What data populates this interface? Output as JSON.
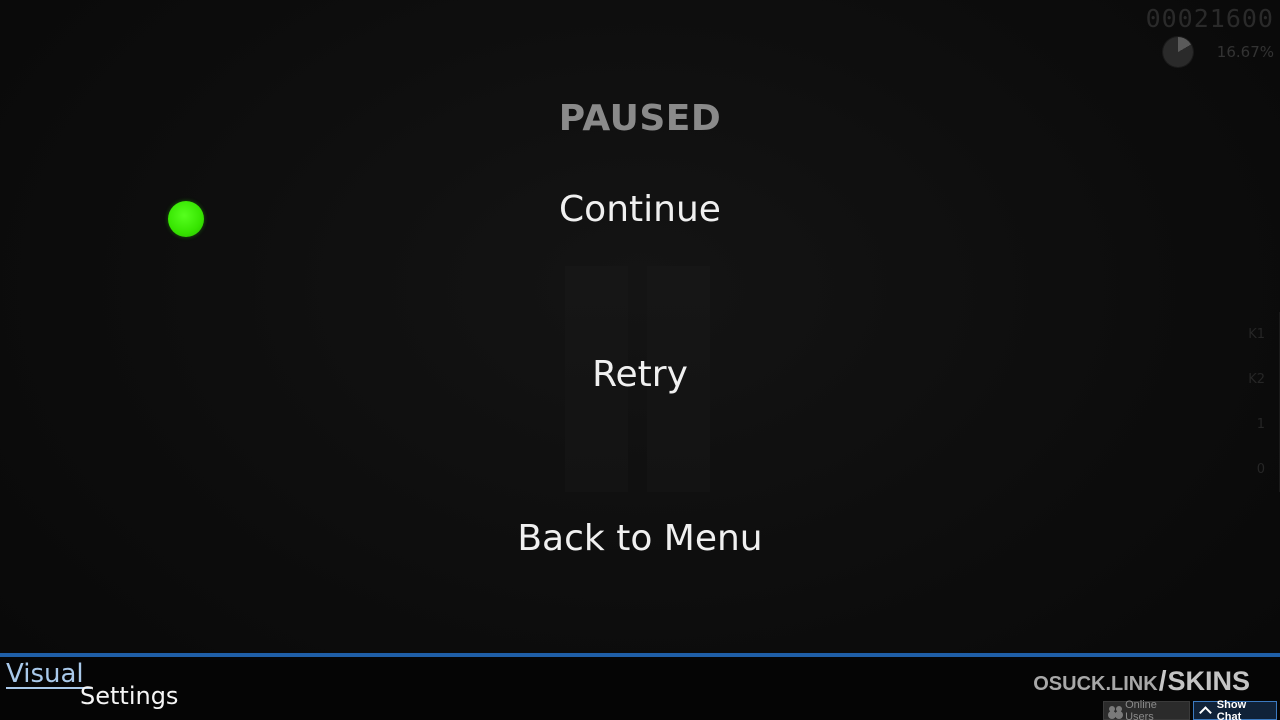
{
  "hud": {
    "score": "00021600",
    "accuracy": "16.67%",
    "keys": [
      "K1",
      "K2",
      "1",
      "0"
    ]
  },
  "pause_menu": {
    "title": "PAUSED",
    "continue_label": "Continue",
    "retry_label": "Retry",
    "back_label": "Back to Menu"
  },
  "bottom_bar": {
    "visual_word": "Visual",
    "settings_word": "Settings",
    "brand_link": "OSUCK.LINK",
    "brand_slash": "/",
    "brand_skins": "SKINS",
    "online_users_label": "Online Users",
    "show_chat_label": "Show Chat"
  },
  "colors": {
    "cursor": "#36e400",
    "accent_blue": "#1f5fa8",
    "visual_label": "#a9c9ea"
  },
  "icons": {
    "users": "users-icon",
    "chevron": "chevron-up-icon",
    "progress": "progress-pie-icon"
  }
}
